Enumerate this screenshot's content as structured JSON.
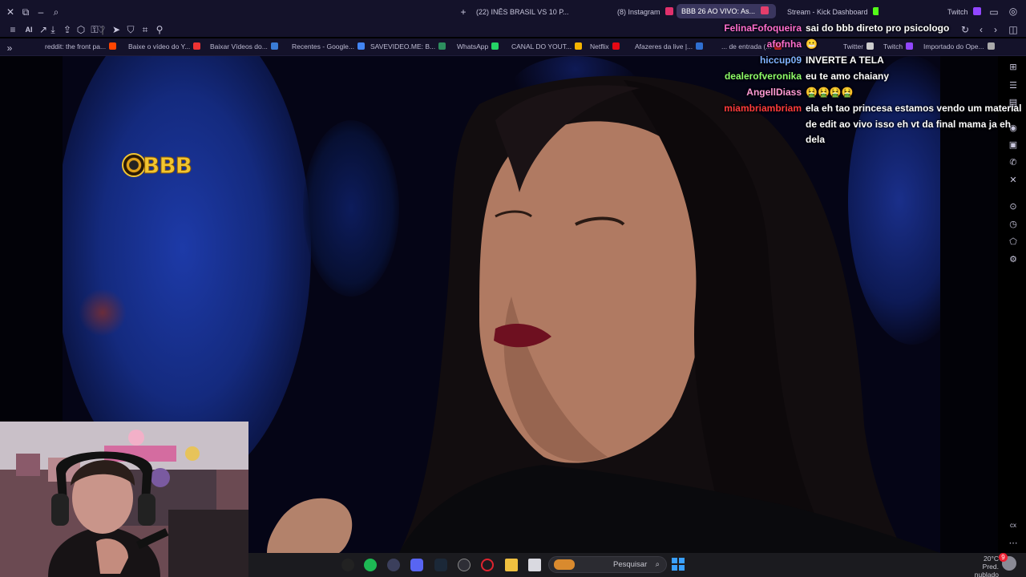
{
  "browser": {
    "tabs": [
      {
        "label": "(22) INÊS BRASIL VS 10 P...",
        "fav": "#ff0000"
      },
      {
        "label": "(8) Instagram",
        "fav": "#e1306c"
      },
      {
        "label": "BBB 26 AO VIVO: As...",
        "fav": "#e53e6b"
      },
      {
        "label": "Stream - Kick Dashboard",
        "fav": "#53fc18"
      },
      {
        "label": "Twitch",
        "fav": "#9146ff"
      }
    ],
    "toolbar_labels": {
      "ai": "AI"
    },
    "bookmarks": [
      {
        "label": "reddit: the front pa...",
        "fav": "#ff4500"
      },
      {
        "label": "Baixe o vídeo do Y...",
        "fav": "#e33"
      },
      {
        "label": "Baixar Vídeos do...",
        "fav": "#3a7bd5"
      },
      {
        "label": "Recentes - Google...",
        "fav": "#4285f4"
      },
      {
        "label": "SAVEVIDEO.ME: B...",
        "fav": "#2d8f5e"
      },
      {
        "label": "WhatsApp",
        "fav": "#25d366"
      },
      {
        "label": "CANAL DO YOUT...",
        "fav": "#f4b400"
      },
      {
        "label": "Netflix",
        "fav": "#e50914"
      },
      {
        "label": "Afazeres da live |...",
        "fav": "#2f6fd1"
      },
      {
        "label": "... de entrada (...",
        "fav": "#c5221f"
      },
      {
        "label": "Twitter",
        "fav": "#cccccc"
      },
      {
        "label": "Twitch",
        "fav": "#9146ff"
      },
      {
        "label": "Importado do Ope...",
        "fav": "#aaaaaa"
      }
    ]
  },
  "chat": {
    "messages": [
      {
        "user": "FelinaFofoqueira",
        "color": "#ff6fd0",
        "text": "sai do bbb direto pro psicologo"
      },
      {
        "user": "afofnha",
        "color": "#ff6fd0",
        "text": "😬"
      },
      {
        "user": "hiccup09",
        "color": "#7fb2ff",
        "text": "INVERTE A TELA"
      },
      {
        "user": "dealerofveronika",
        "color": "#8fff6a",
        "text": "eu te amo chaiany"
      },
      {
        "user": "AngellDiass",
        "color": "#ff9ad5",
        "text": "🤮🤮🤮🤮"
      },
      {
        "user": "miambriambriam",
        "color": "#ff3b3b",
        "text": "ela eh tao princesa estamos vendo um material de edit ao vivo isso eh vt da final mama ja eh dela"
      }
    ]
  },
  "video": {
    "logo_text": "BBB"
  },
  "taskbar": {
    "search_placeholder": "Pesquisar",
    "weather_temp": "20°C",
    "weather_desc": "Pred. nublado",
    "notification_count": "9"
  }
}
